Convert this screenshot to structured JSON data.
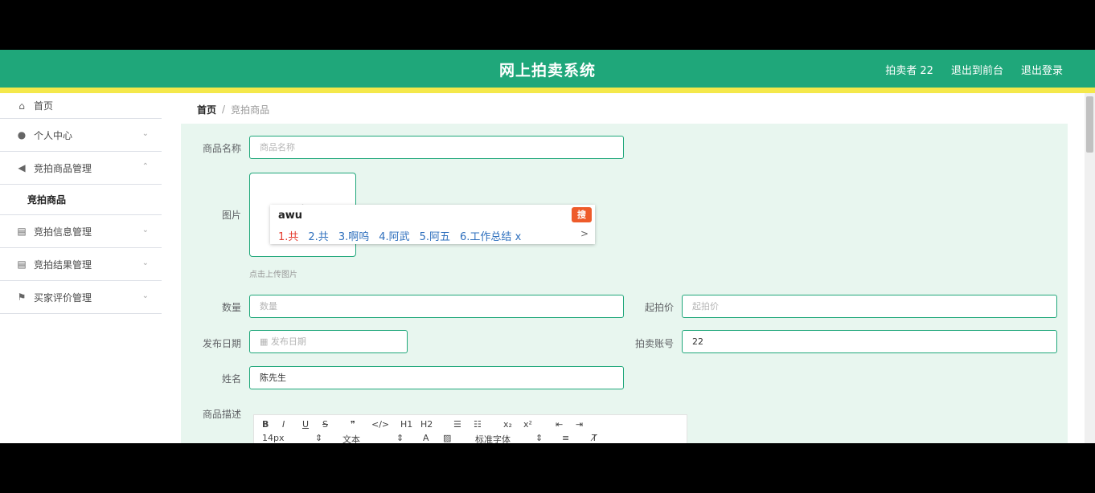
{
  "header": {
    "title": "网上拍卖系统",
    "user": "拍卖者 22",
    "back_to_front": "退出到前台",
    "logout": "退出登录"
  },
  "sidebar": {
    "items": [
      {
        "label": "首页",
        "icon": "home-icon"
      },
      {
        "label": "个人中心",
        "icon": "user-icon"
      },
      {
        "label": "竞拍商品管理",
        "icon": "send-icon"
      },
      {
        "label": "竞拍信息管理",
        "icon": "document-icon"
      },
      {
        "label": "竞拍结果管理",
        "icon": "document-icon"
      },
      {
        "label": "买家评价管理",
        "icon": "flag-icon"
      }
    ],
    "sub_item": "竞拍商品"
  },
  "breadcrumb": {
    "home": "首页",
    "separator": "/",
    "current": "竞拍商品"
  },
  "form": {
    "name_label": "商品名称",
    "name_placeholder": "商品名称",
    "image_label": "图片",
    "upload_hint": "点击上传图片",
    "quantity_label": "数量",
    "quantity_placeholder": "数量",
    "start_price_label": "起拍价",
    "start_price_placeholder": "起拍价",
    "publish_date_label": "发布日期",
    "publish_date_placeholder": "发布日期",
    "auction_account_label": "拍卖账号",
    "auction_account_value": "22",
    "surname_label": "姓名",
    "surname_value": "陈先生",
    "desc_label": "商品描述"
  },
  "editor": {
    "row1": [
      "B",
      "I",
      "U",
      "S",
      "❞",
      "</>",
      "H1",
      "H2",
      "☰",
      "☷",
      "x₂",
      "x²",
      "⇤",
      "⇥"
    ],
    "font_size": "14px",
    "text_style": "文本",
    "font_family": "标准字体"
  },
  "ime": {
    "typed": "awu",
    "candidates": [
      "1.共",
      "2.共",
      "3.啊呜",
      "4.阿武",
      "5.阿五",
      "6.工作总结 x"
    ],
    "next": ">",
    "logo": "搜"
  }
}
